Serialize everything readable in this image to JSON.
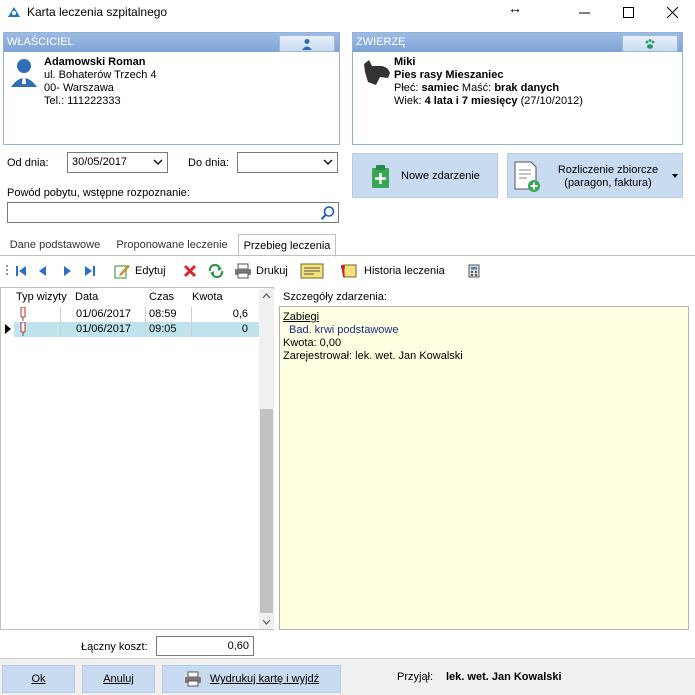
{
  "window": {
    "title": "Karta leczenia szpitalnego"
  },
  "owner": {
    "header": "WŁAŚCICIEL",
    "name": "Adamowski Roman",
    "street": "ul. Bohaterów Trzech 4",
    "city": "00-  Warszawa",
    "phone": "Tel.: 111222333"
  },
  "animal": {
    "header": "ZWIERZĘ",
    "name": "Miki",
    "species_prefix": "Pies rasy",
    "breed": "Mieszaniec",
    "sex_label": "Płeć:",
    "sex": "samiec",
    "color_label": "Maść:",
    "color": "brak danych",
    "age_label": "Wiek:",
    "age": "4 lata i 7 miesięcy",
    "birth": "(27/10/2012)"
  },
  "filters": {
    "from_label": "Od dnia:",
    "from_value": "30/05/2017",
    "to_label": "Do dnia:",
    "to_value": "",
    "reason_label": "Powód pobytu, wstępne rozpoznanie:",
    "reason_value": ""
  },
  "actions": {
    "new_event": "Nowe zdarzenie",
    "summary_line1": "Rozliczenie zbiorcze",
    "summary_line2": "(paragon, faktura)"
  },
  "tabs": [
    {
      "label": "Dane podstawowe"
    },
    {
      "label": "Proponowane leczenie"
    },
    {
      "label": "Przebieg leczenia"
    }
  ],
  "toolbar": {
    "edit": "Edytuj",
    "print": "Drukuj",
    "history": "Historia leczenia"
  },
  "grid": {
    "columns": [
      "Typ wizyty",
      "Data",
      "Czas",
      "Kwota"
    ],
    "rows": [
      {
        "date": "01/06/2017",
        "time": "08:59",
        "amount": "0,6"
      },
      {
        "date": "01/06/2017",
        "time": "09:05",
        "amount": "0"
      }
    ]
  },
  "details": {
    "label": "Szczegóły zdarzenia:",
    "category": "Zabiegi",
    "item": "Bad. krwi podstawowe",
    "amount": "Kwota: 0,00",
    "registered": "Zarejestrował: lek. wet. Jan Kowalski"
  },
  "total": {
    "label": "Łączny koszt:",
    "value": "0,60"
  },
  "footer": {
    "ok": "Ok",
    "cancel": "Anuluj",
    "print_exit": "Wydrukuj kartę i wyjdź",
    "admitted_label": "Przyjął:",
    "admitted_by": "lek. wet. Jan Kowalski"
  },
  "colors": {
    "panel_header": "#8fb2d6",
    "button_bg": "#c9dbf1",
    "details_bg": "#ffffe1",
    "selected_row": "#bfe4ee"
  }
}
